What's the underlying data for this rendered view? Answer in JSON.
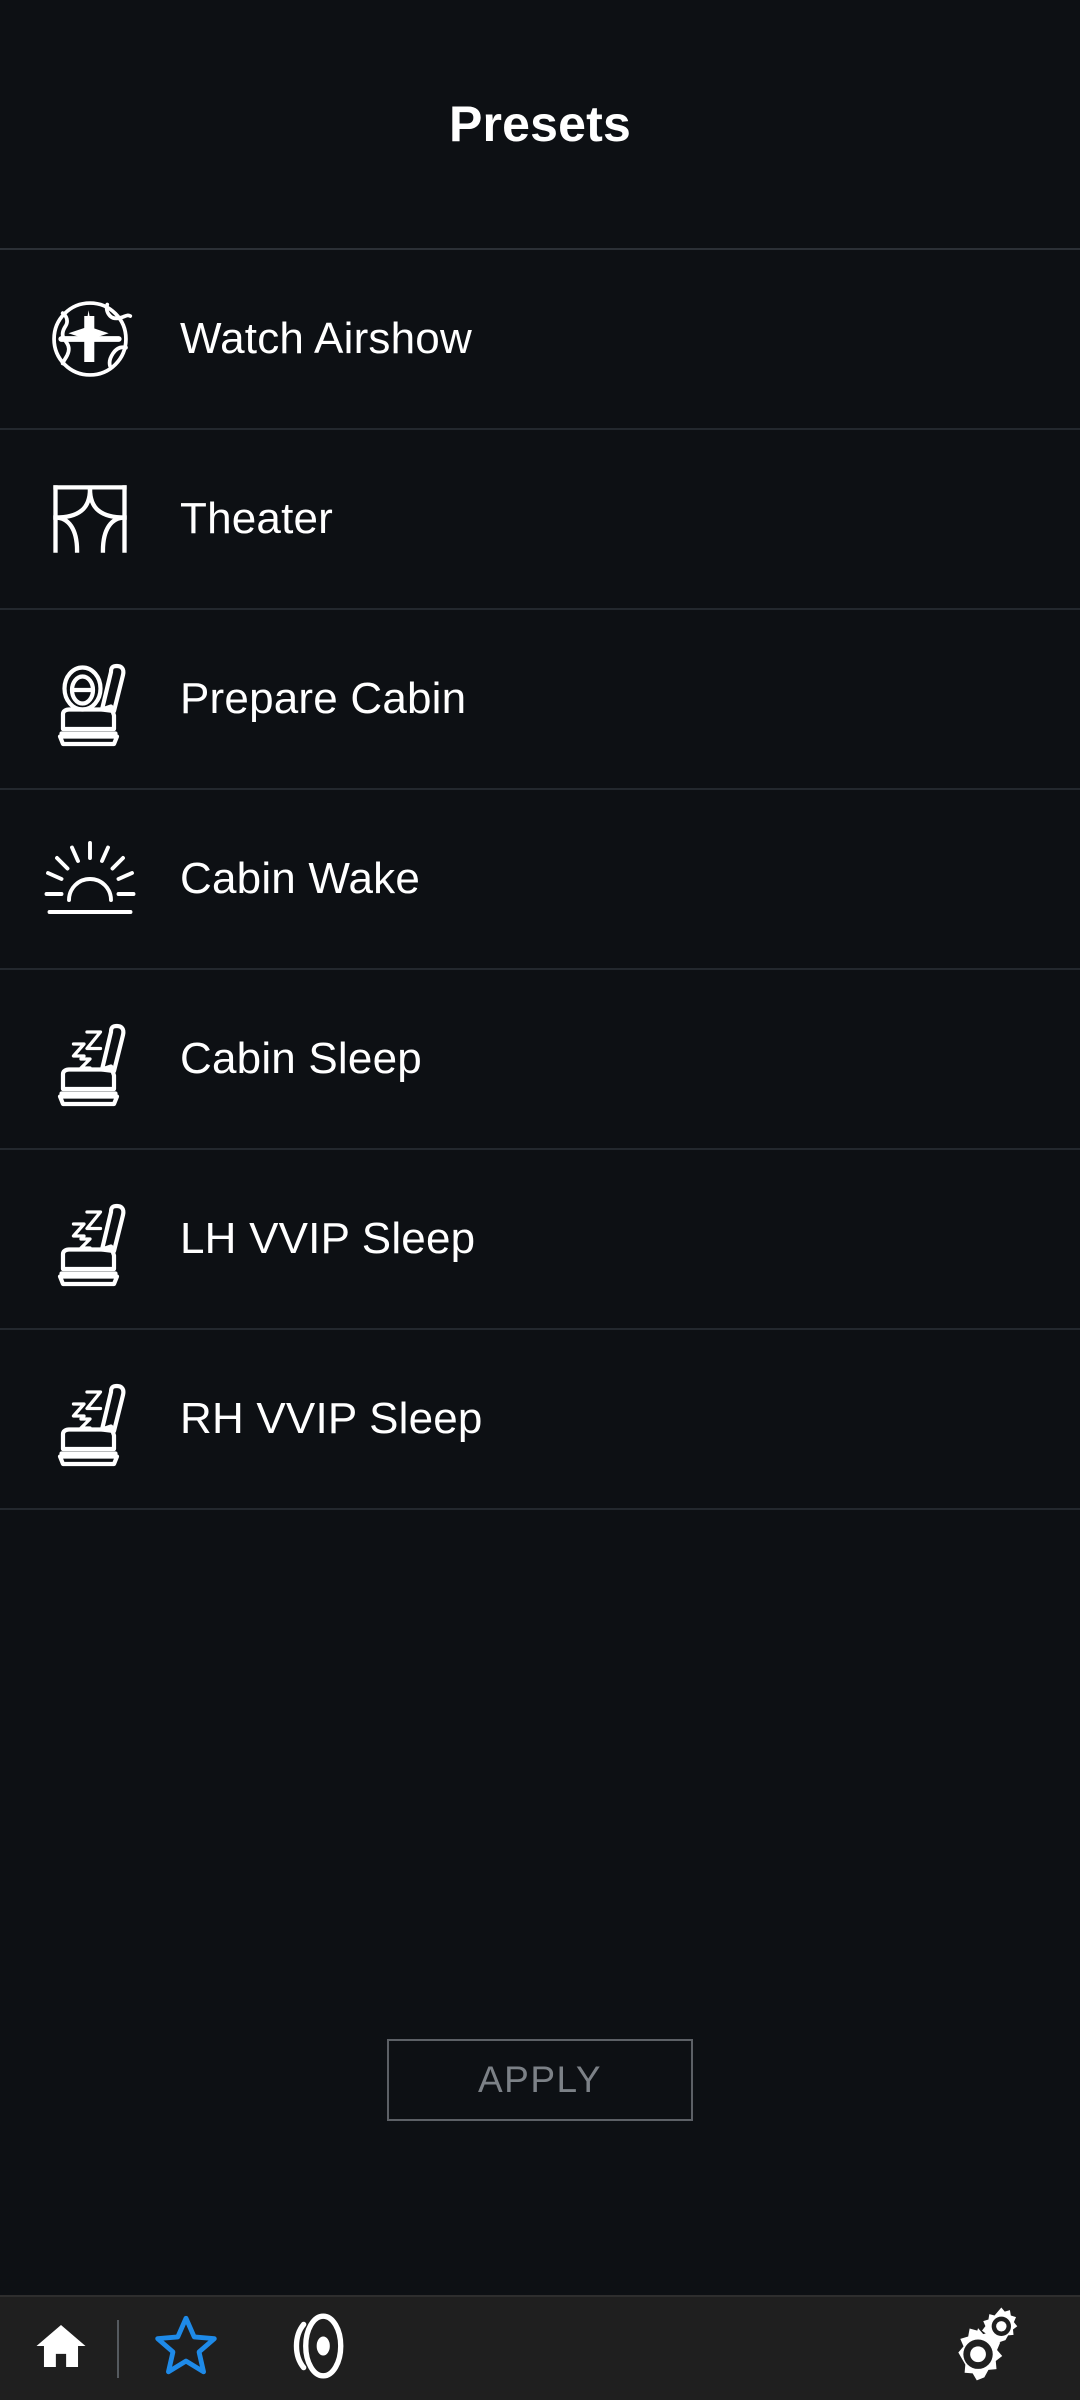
{
  "header": {
    "title": "Presets"
  },
  "colors": {
    "background": "#0d1014",
    "row_divider": "#23282e",
    "header_divider": "#2b3036",
    "text_primary": "#ffffff",
    "apply_border": "#5c6066",
    "apply_text": "#7c8187",
    "bottom_bar_background": "#1f1f1f",
    "nav_icon_white": "#ffffff",
    "nav_star_blue": "#1e8ae8"
  },
  "presets": [
    {
      "label": "Watch Airshow",
      "icon": "globe-airplane-icon"
    },
    {
      "label": "Theater",
      "icon": "theater-curtain-icon"
    },
    {
      "label": "Prepare Cabin",
      "icon": "seat-pillow-icon"
    },
    {
      "label": "Cabin Wake",
      "icon": "sunrise-icon"
    },
    {
      "label": "Cabin Sleep",
      "icon": "seat-sleep-icon"
    },
    {
      "label": "LH VVIP Sleep",
      "icon": "seat-sleep-icon"
    },
    {
      "label": "RH VVIP Sleep",
      "icon": "seat-sleep-icon"
    }
  ],
  "apply": {
    "label": "APPLY",
    "enabled": false
  },
  "bottom_nav": {
    "items": [
      {
        "name": "home",
        "icon": "home-icon",
        "active": false
      },
      {
        "name": "favorites",
        "icon": "star-icon",
        "active": true
      },
      {
        "name": "sound",
        "icon": "speaker-icon",
        "active": false
      },
      {
        "name": "settings",
        "icon": "gears-icon",
        "active": false
      }
    ]
  }
}
